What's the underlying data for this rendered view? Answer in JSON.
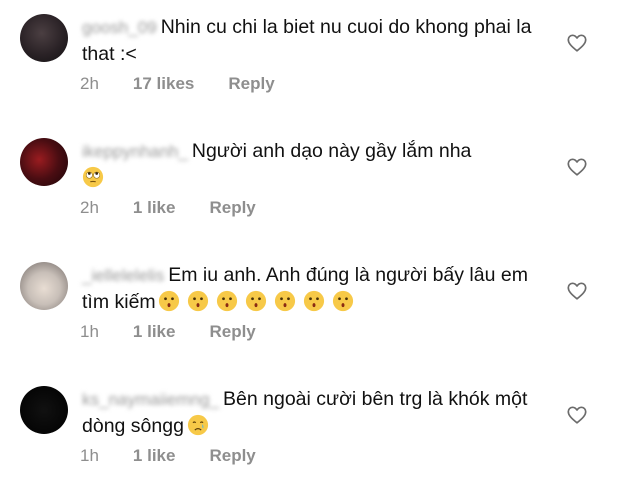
{
  "comments": [
    {
      "username": "goosh_09",
      "text": "Nhin cu chi la biet nu cuoi do khong phai la that :<",
      "time": "2h",
      "likes": "17 likes",
      "reply": "Reply",
      "avatar_color": "#2a2226",
      "emojis": []
    },
    {
      "username": "ikeppynhanh_",
      "text": "Người anh dạo này gầy lắm nha",
      "time": "2h",
      "likes": "1 like",
      "reply": "Reply",
      "avatar_color": "#4a0d12",
      "emojis": [
        "face-with-rolling-eyes"
      ]
    },
    {
      "username": "_iellelelelis",
      "text": "Em iu anh. Anh đúng là người bấy lâu em tìm kiếm",
      "time": "1h",
      "likes": "1 like",
      "reply": "Reply",
      "avatar_color": "#c8bfb8",
      "emojis": [
        "kissing-face",
        "kissing-face",
        "kissing-face",
        "kissing-face",
        "kissing-face",
        "kissing-face",
        "kissing-face"
      ]
    },
    {
      "username": "ks_naymaiiemng_",
      "text": "Bên ngoài cười bên trg là khók một dòng sôngg",
      "time": "1h",
      "likes": "1 like",
      "reply": "Reply",
      "avatar_color": "#050505",
      "emojis": [
        "crying-face"
      ]
    }
  ],
  "icons": {
    "like": "heart-outline-icon"
  },
  "colors": {
    "meta_text": "#8e8e8e",
    "body_text": "#111111",
    "background": "#ffffff"
  }
}
